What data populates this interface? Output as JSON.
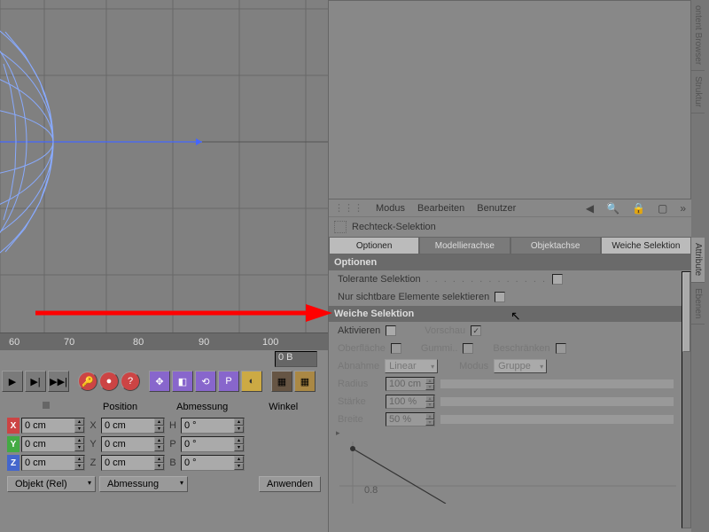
{
  "ruler": {
    "ticks": [
      "60",
      "70",
      "80",
      "90",
      "100"
    ]
  },
  "timeline": {
    "frame": "0 B"
  },
  "coords": {
    "headers": [
      "Position",
      "Abmessung",
      "Winkel"
    ],
    "labels": [
      "X",
      "Y",
      "Z"
    ],
    "ang_labels": [
      "H",
      "P",
      "B"
    ],
    "pos": [
      "0 cm",
      "0 cm",
      "0 cm"
    ],
    "size": [
      "0 cm",
      "0 cm",
      "0 cm"
    ],
    "ang": [
      "0 °",
      "0 °",
      "0 °"
    ],
    "basis": "Objekt (Rel)",
    "dim_btn": "Abmessung",
    "apply": "Anwenden"
  },
  "panel": {
    "menu": [
      "Modus",
      "Bearbeiten",
      "Benutzer"
    ],
    "title": "Rechteck-Selektion",
    "tabs": [
      "Optionen",
      "Modellierachse",
      "Objektachse",
      "Weiche Selektion"
    ],
    "sec1": "Optionen",
    "opt1": "Tolerante Selektion",
    "opt2": "Nur sichtbare Elemente selektieren",
    "sec2": "Weiche Selektion",
    "activate": "Aktivieren",
    "preview": "Vorschau",
    "surface": "Oberfläche",
    "rubber": "Gummi..",
    "restrict": "Beschränken",
    "falloff": "Abnahme",
    "falloff_v": "Linear",
    "mode": "Modus",
    "mode_v": "Gruppe",
    "radius": "Radius",
    "radius_v": "100 cm",
    "strength": "Stärke",
    "strength_v": "100 %",
    "width": "Breite",
    "width_v": "50 %",
    "graph_tick": "0.8"
  },
  "side_tabs": [
    "ontent Browser",
    "Struktur",
    "Attribute",
    "Ebenen"
  ]
}
